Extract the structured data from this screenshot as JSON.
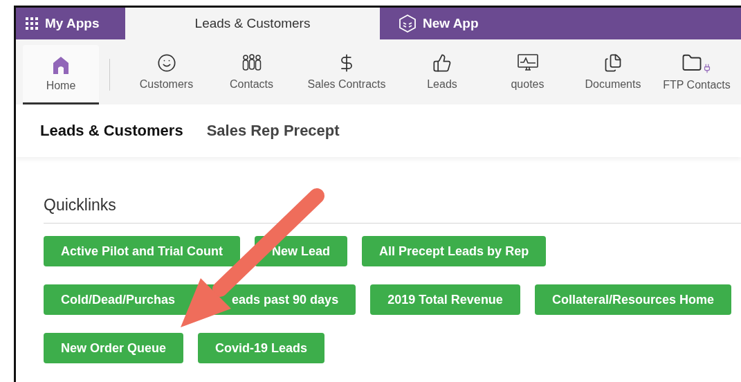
{
  "app_bar": {
    "tabs": [
      {
        "label": "My Apps",
        "kind": "launcher",
        "selected": false
      },
      {
        "label": "Leads & Customers",
        "kind": "app",
        "selected": true
      },
      {
        "label": "New App",
        "kind": "new",
        "selected": false
      }
    ]
  },
  "nav": {
    "items": [
      {
        "label": "Home",
        "selected": true
      },
      {
        "label": "Customers",
        "selected": false
      },
      {
        "label": "Contacts",
        "selected": false
      },
      {
        "label": "Sales Contracts",
        "selected": false
      },
      {
        "label": "Leads",
        "selected": false
      },
      {
        "label": "quotes",
        "selected": false
      },
      {
        "label": "Documents",
        "selected": false
      },
      {
        "label": "FTP Contacts",
        "selected": false
      }
    ]
  },
  "section_tabs": [
    {
      "label": "Leads & Customers",
      "selected": true
    },
    {
      "label": "Sales Rep Precept",
      "selected": false
    }
  ],
  "quicklinks": {
    "title": "Quicklinks",
    "lines": [
      {
        "buttons": [
          {
            "label": "Active Pilot and Trial Count"
          },
          {
            "label": "New Lead"
          },
          {
            "label": "All Precept Leads by Rep"
          }
        ]
      },
      {
        "buttons": [
          {
            "text_parts": [
              "Cold/Dead/Purchas",
              "eads past 90 days"
            ]
          },
          {
            "label": "2019 Total Revenue"
          },
          {
            "label": "Collateral/Resources Home"
          }
        ]
      },
      {
        "buttons": [
          {
            "label": "New Order Queue"
          },
          {
            "label": "Covid-19 Leads"
          }
        ]
      }
    ]
  },
  "annotation": {
    "kind": "arrow",
    "color": "#ef6d5b"
  }
}
